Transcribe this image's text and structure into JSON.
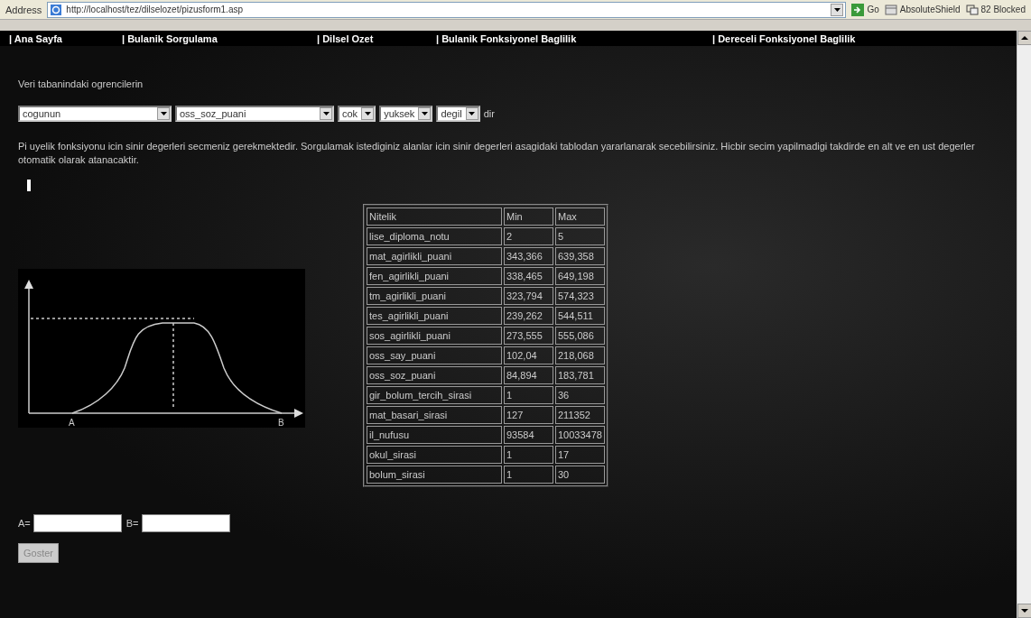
{
  "address_bar": {
    "label": "Address",
    "url": "http://localhost/tez/dilselozet/pizusform1.asp",
    "go": "Go",
    "toolbar_items": [
      "AbsoluteShield",
      "82 Blocked"
    ]
  },
  "nav": [
    "| Ana Sayfa",
    "| Bulanik Sorgulama",
    "| Dilsel Ozet",
    "| Bulanik Fonksiyonel Baglilik",
    "| Dereceli Fonksiyonel Baglilik"
  ],
  "intro": "Veri tabanindaki ogrencilerin",
  "query": {
    "selects": [
      "cogunun",
      "oss_soz_puani",
      "cok",
      "yuksek",
      "degil"
    ],
    "suffix": "dir"
  },
  "instructions": "Pi uyelik fonksiyonu icin sinir degerleri secmeniz gerekmektedir. Sorgulamak istediginiz alanlar icin sinir degerleri asagidaki tablodan yararlanarak secebilirsiniz. Hicbir secim yapilmadigi takdirde en alt ve en ust degerler otomatik olarak atanacaktir.",
  "diagram": {
    "left_label": "A",
    "right_label": "B"
  },
  "table": {
    "columns": [
      "Nitelik",
      "Min",
      "Max"
    ],
    "rows": [
      [
        "lise_diploma_notu",
        "2",
        "5"
      ],
      [
        "mat_agirlikli_puani",
        "343,366",
        "639,358"
      ],
      [
        "fen_agirlikli_puani",
        "338,465",
        "649,198"
      ],
      [
        "tm_agirlikli_puani",
        "323,794",
        "574,323"
      ],
      [
        "tes_agirlikli_puani",
        "239,262",
        "544,511"
      ],
      [
        "sos_agirlikli_puani",
        "273,555",
        "555,086"
      ],
      [
        "oss_say_puani",
        "102,04",
        "218,068"
      ],
      [
        "oss_soz_puani",
        "84,894",
        "183,781"
      ],
      [
        "gir_bolum_tercih_sirasi",
        "1",
        "36"
      ],
      [
        "mat_basari_sirasi",
        "127",
        "211352"
      ],
      [
        "il_nufusu",
        "93584",
        "10033478"
      ],
      [
        "okul_sirasi",
        "1",
        "17"
      ],
      [
        "bolum_sirasi",
        "1",
        "30"
      ]
    ]
  },
  "inputs": [
    {
      "label": "A="
    },
    {
      "label": "B="
    }
  ],
  "button": "Goster"
}
